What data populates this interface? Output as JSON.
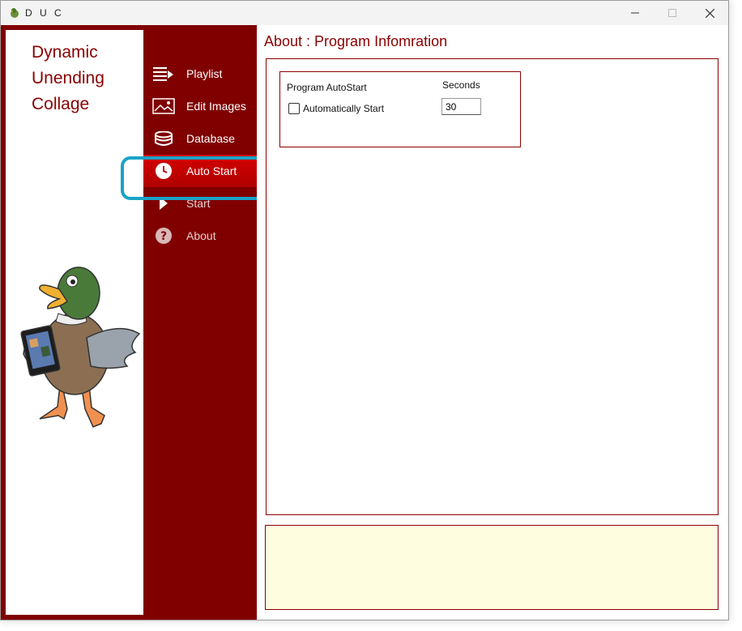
{
  "window": {
    "title": "D U C",
    "controls": [
      "minimize",
      "maximize",
      "close"
    ]
  },
  "brand": {
    "lines": [
      "Dynamic",
      "Unending",
      "Collage"
    ]
  },
  "nav": {
    "items": [
      {
        "label": "Playlist",
        "icon": "playlist-icon",
        "active": false
      },
      {
        "label": "Edit Images",
        "icon": "image-icon",
        "active": false
      },
      {
        "label": "Database",
        "icon": "database-icon",
        "active": false
      },
      {
        "label": "Auto Start",
        "icon": "clock-icon",
        "active": true
      },
      {
        "label": "Start",
        "icon": "play-icon",
        "active": false
      },
      {
        "label": "About",
        "icon": "help-icon",
        "active": false
      }
    ]
  },
  "main": {
    "title": "About : Program Infomration",
    "autostart": {
      "group_title": "Program AutoStart",
      "checkbox_label": "Automatically Start",
      "checked": false,
      "seconds_label": "Seconds",
      "seconds_value": "30"
    },
    "status_text": ""
  },
  "colors": {
    "accent": "#800000",
    "active_nav": "#c80000",
    "highlight": "#1aa3c8",
    "status_bg": "#fffde0"
  }
}
